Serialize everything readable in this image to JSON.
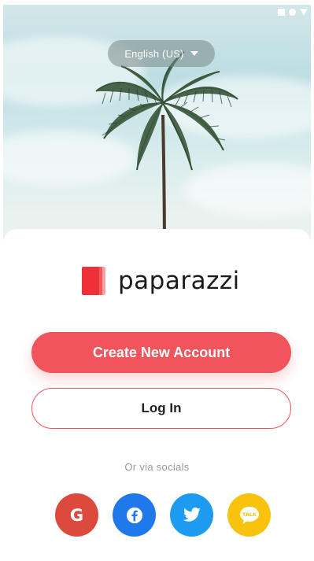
{
  "language_selector": {
    "label": "English (US)"
  },
  "brand": {
    "name": "paparazzi"
  },
  "actions": {
    "create_account_label": "Create New Account",
    "login_label": "Log In"
  },
  "socials": {
    "label": "Or via socials",
    "items": [
      {
        "name": "google-icon",
        "glyph": "G",
        "color": "#dc4a3d"
      },
      {
        "name": "facebook-icon",
        "color": "#1f79ea"
      },
      {
        "name": "twitter-icon",
        "color": "#1d9bf0"
      },
      {
        "name": "talk-icon",
        "glyph": "TALK",
        "color": "#f8c20d"
      }
    ]
  },
  "colors": {
    "accent": "#f2545b"
  }
}
